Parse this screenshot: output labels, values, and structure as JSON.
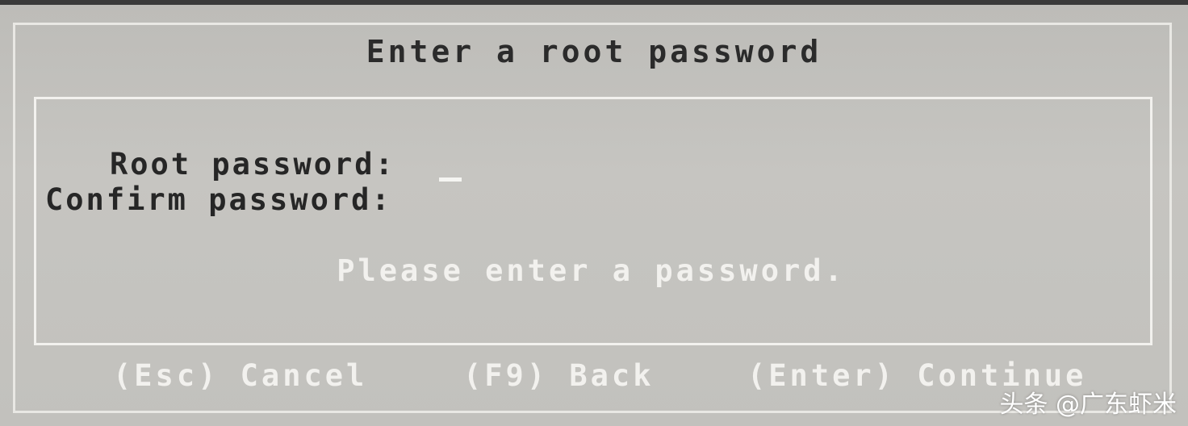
{
  "dialog": {
    "title": "Enter a root password",
    "fields": {
      "root_label": "Root password:",
      "confirm_label": "Confirm password:",
      "root_value": "",
      "confirm_value": ""
    },
    "message": "Please enter a password.",
    "buttons": {
      "cancel": "(Esc) Cancel",
      "back": "(F9) Back",
      "continue": "(Enter) Continue"
    }
  },
  "watermark": "头条 @广东虾米",
  "colors": {
    "background": "#c2c1bd",
    "frame": "#f2f1ee",
    "text_dark": "#262626",
    "text_light": "#f2f1ee"
  }
}
